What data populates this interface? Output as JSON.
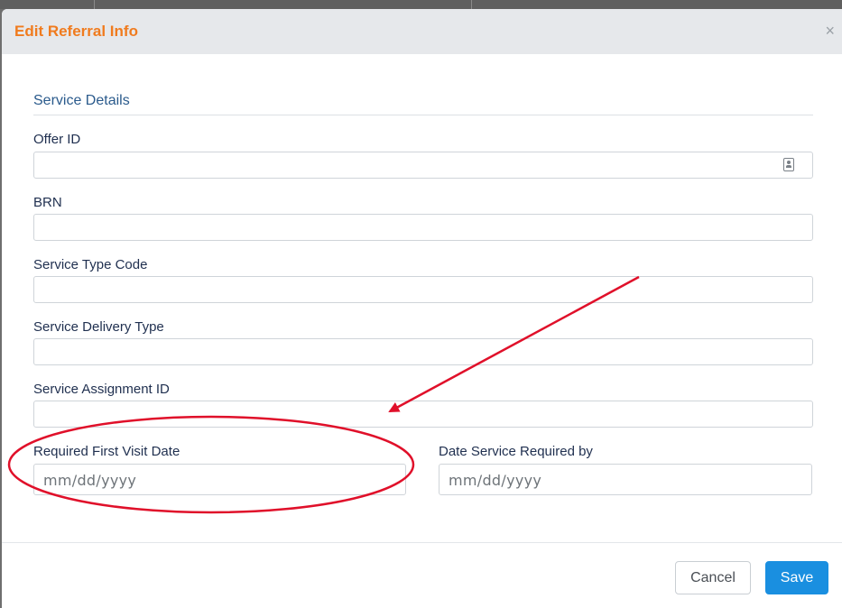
{
  "modal": {
    "title": "Edit Referral Info",
    "close_glyph": "×"
  },
  "section": {
    "title": "Service Details"
  },
  "fields": {
    "offer_id": {
      "label": "Offer ID",
      "value": ""
    },
    "brn": {
      "label": "BRN",
      "value": ""
    },
    "service_type_code": {
      "label": "Service Type Code",
      "value": ""
    },
    "service_delivery_type": {
      "label": "Service Delivery Type",
      "value": ""
    },
    "service_assignment_id": {
      "label": "Service Assignment ID",
      "value": ""
    },
    "required_first_visit_date": {
      "label": "Required First Visit Date",
      "placeholder": "mm/dd/yyyy"
    },
    "date_service_required_by": {
      "label": "Date Service Required by",
      "placeholder": "mm/dd/yyyy"
    }
  },
  "footer": {
    "cancel_label": "Cancel",
    "save_label": "Save"
  },
  "colors": {
    "title": "#f07b1e",
    "section": "#2a5a8c",
    "primary": "#1a8fe0",
    "annotation": "#e0102a"
  },
  "icons": {
    "offer_lookup": "contact-card-icon",
    "close": "close-icon"
  }
}
